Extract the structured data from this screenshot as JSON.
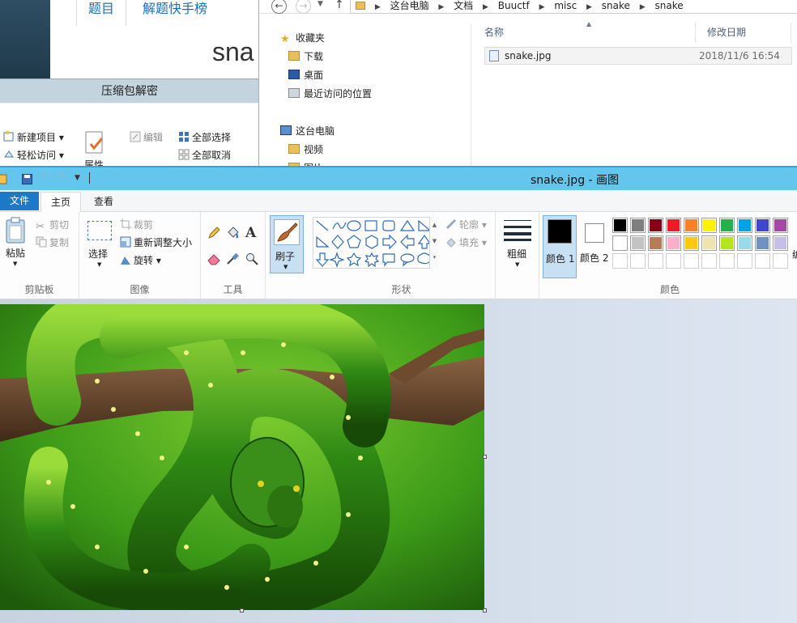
{
  "bg_app": {
    "tabs": [
      "题目",
      "解题快手榜"
    ],
    "big_text": "sna",
    "bar_title": "压缩包解密",
    "ribbon_items": {
      "new_item": "新建项目 ▾",
      "easy_access": "轻松访问 ▾",
      "properties": "属性",
      "edit": "编辑",
      "select_all": "全部选择",
      "select_none": "全部取消"
    }
  },
  "explorer": {
    "breadcrumbs": [
      "这台电脑",
      "文档",
      "Buuctf",
      "misc",
      "snake",
      "snake"
    ],
    "nav": {
      "favorites": "收藏夹",
      "downloads": "下载",
      "desktop": "桌面",
      "recent": "最近访问的位置",
      "this_pc": "这台电脑",
      "videos": "视频",
      "pictures": "图片"
    },
    "columns": {
      "name": "名称",
      "modified": "修改日期"
    },
    "files": [
      {
        "name": "snake.jpg",
        "modified": "2018/11/6 16:54"
      }
    ]
  },
  "paint": {
    "title": "snake.jpg - 画图",
    "tabs": {
      "file": "文件",
      "home": "主页",
      "view": "查看"
    },
    "clipboard": {
      "paste": "粘贴",
      "cut": "剪切",
      "copy": "复制",
      "label": "剪贴板"
    },
    "image": {
      "select": "选择",
      "crop": "裁剪",
      "resize": "重新调整大小",
      "rotate": "旋转 ▾",
      "label": "图像"
    },
    "tools": {
      "label": "工具"
    },
    "brushes": {
      "label": "刷子"
    },
    "shapes": {
      "outline": "轮廓 ▾",
      "fill": "填充 ▾",
      "label": "形状"
    },
    "size": {
      "label": "粗细"
    },
    "colors": {
      "color1": "颜色 1",
      "color2": "颜色 2",
      "edit": "编",
      "label": "颜色",
      "color1_value": "#000000",
      "color2_value": "#ffffff",
      "row1": [
        "#000000",
        "#7f7f7f",
        "#880015",
        "#ed1c24",
        "#ff7f27",
        "#fff200",
        "#22b14c",
        "#00a2e8",
        "#3f48cc",
        "#a349a4"
      ],
      "row2": [
        "#ffffff",
        "#c3c3c3",
        "#b97a57",
        "#ffaec9",
        "#ffc90e",
        "#efe4b0",
        "#b5e61d",
        "#99d9ea",
        "#7092be",
        "#c8bfe7"
      ]
    }
  }
}
